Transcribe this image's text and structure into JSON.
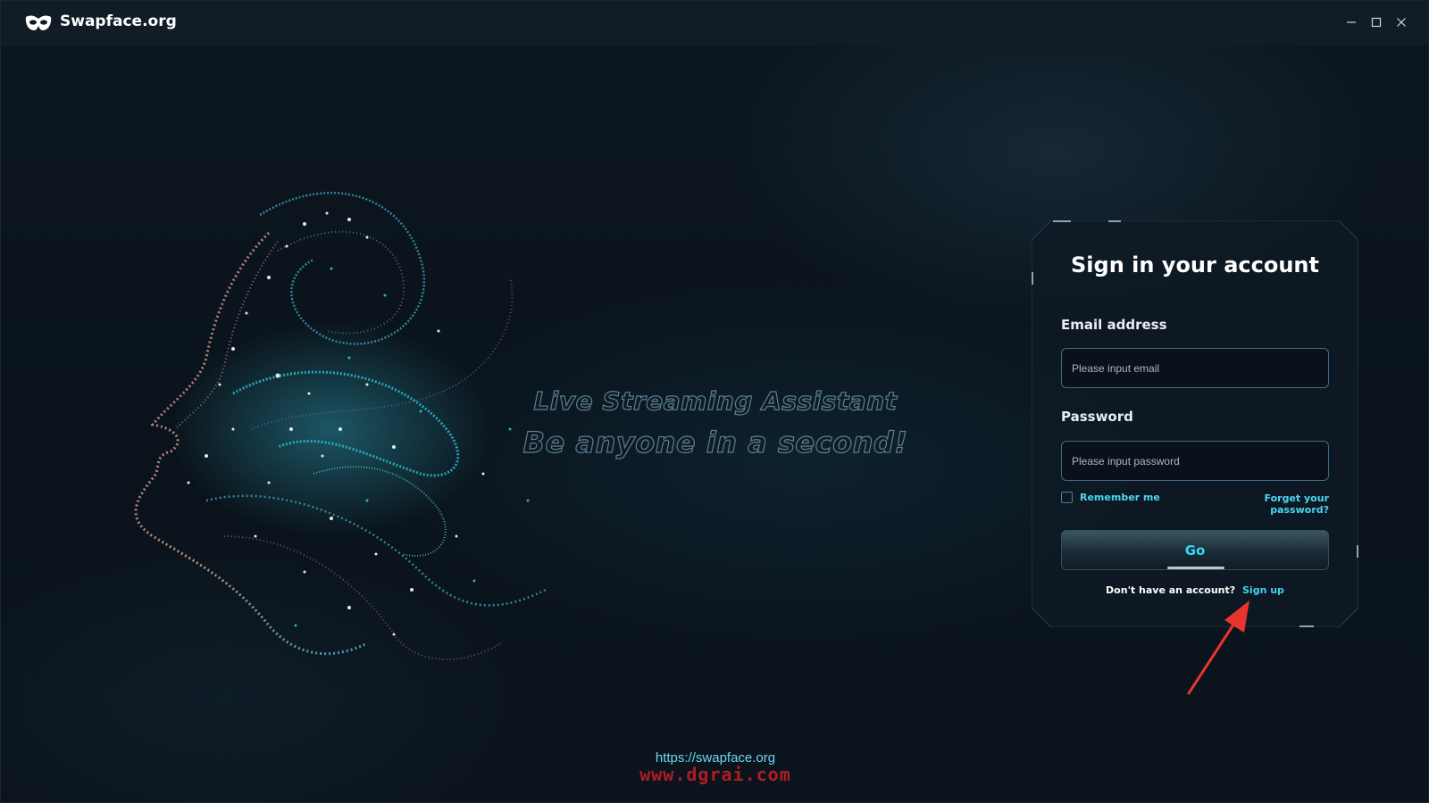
{
  "window": {
    "title": "Swapface.org",
    "controls": {
      "minimize": "—",
      "maximize": "☐",
      "close": "✕"
    }
  },
  "hero": {
    "art_icon": "particle-face-art",
    "tagline_line1": "Live Streaming Assistant",
    "tagline_line2": "Be anyone in a second!"
  },
  "login": {
    "title": "Sign in your account",
    "email_label": "Email address",
    "email_placeholder": "Please input email",
    "email_value": "",
    "password_label": "Password",
    "password_placeholder": "Please input password",
    "password_value": "",
    "remember_label": "Remember me",
    "remember_checked": false,
    "forgot_label": "Forget your password?",
    "submit_label": "Go",
    "signup_prompt": "Don't have an account?",
    "signup_label": "Sign up"
  },
  "annotation": {
    "arrow_icon": "red-arrow-icon",
    "arrow_color": "#e8332e"
  },
  "footer": {
    "url": "https://swapface.org",
    "watermark": "www.dgrai.com"
  },
  "colors": {
    "accent": "#35d7f2",
    "background": "#0a1119",
    "titlebar": "#121c26",
    "input_border": "#3d6b86"
  }
}
